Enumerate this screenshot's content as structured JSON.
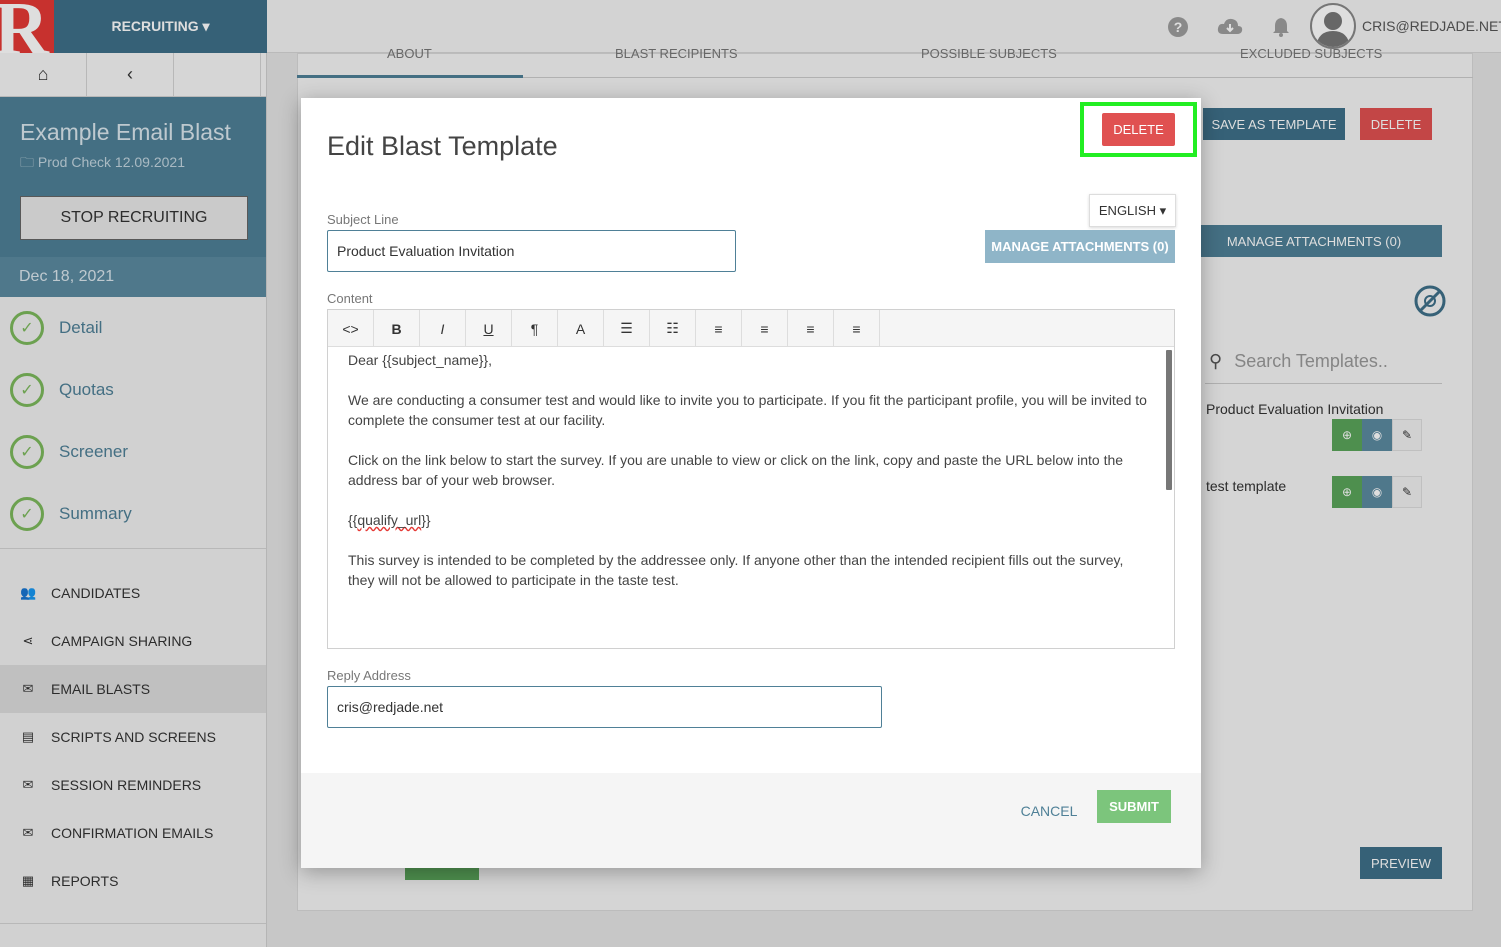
{
  "topbar": {
    "logo_letter": "R",
    "recruit_menu": "RECRUITING ▾",
    "user": "CRIS@REDJADE.NET"
  },
  "sidebar": {
    "nav_home": "⌂",
    "nav_back": "‹",
    "project_title": "Example Email Blast",
    "project_sub": "🗀 Prod Check 12.09.2021",
    "stop_button": "STOP RECRUITING",
    "date": "Dec 18, 2021",
    "steps": [
      {
        "label": "Detail"
      },
      {
        "label": "Quotas"
      },
      {
        "label": "Screener"
      },
      {
        "label": "Summary"
      }
    ],
    "menu": [
      {
        "label": "CANDIDATES",
        "icon": "people-icon"
      },
      {
        "label": "CAMPAIGN SHARING",
        "icon": "share-icon"
      },
      {
        "label": "EMAIL BLASTS",
        "icon": "mail-icon"
      },
      {
        "label": "SCRIPTS AND SCREENS",
        "icon": "chat-icon"
      },
      {
        "label": "SESSION REMINDERS",
        "icon": "mail-icon"
      },
      {
        "label": "CONFIRMATION EMAILS",
        "icon": "mail-icon"
      },
      {
        "label": "REPORTS",
        "icon": "grid-icon"
      }
    ]
  },
  "background": {
    "tabs": [
      "ABOUT",
      "BLAST RECIPIENTS",
      "POSSIBLE SUBJECTS",
      "EXCLUDED SUBJECTS"
    ],
    "save_template": "SAVE AS TEMPLATE",
    "delete": "DELETE",
    "manage_attachments": "MANAGE ATTACHMENTS (0)",
    "search_placeholder": "Search Templates..",
    "templates": [
      "Product Evaluation Invitation",
      "test template"
    ],
    "preview": "PREVIEW"
  },
  "modal": {
    "title": "Edit Blast Template",
    "delete": "DELETE",
    "subject_label": "Subject Line",
    "subject_value": "Product Evaluation Invitation",
    "language": "ENGLISH ▾",
    "attachments": "MANAGE ATTACHMENTS (0)",
    "content_label": "Content",
    "toolbar": [
      "<>",
      "B",
      "I",
      "U",
      "¶",
      "A",
      "☰",
      "☷",
      "≡",
      "≡",
      "≡",
      "≡"
    ],
    "body": {
      "p1": "Dear {{subject_name}},",
      "p2": "We are conducting a consumer test and would like to invite you to participate. If you fit the participant profile, you will be invited to complete the consumer test at our facility.",
      "p3": "Click on the link below to start the survey. If you are unable to view or click on the link, copy and paste the URL below into the address bar of your web browser.",
      "p4_pre": "{{",
      "p4_word": "qualify_url",
      "p4_post": "}}",
      "p5": "This survey is intended to be completed by the addressee only. If anyone other than the intended recipient fills out the survey, they will not be allowed to participate in the taste test."
    },
    "reply_label": "Reply Address",
    "reply_value": "cris@redjade.net",
    "cancel": "CANCEL",
    "submit": "SUBMIT"
  },
  "colors": {
    "accent": "#4f8097",
    "danger": "#e05151",
    "success": "#7cc57c",
    "highlight": "#22ee22"
  }
}
